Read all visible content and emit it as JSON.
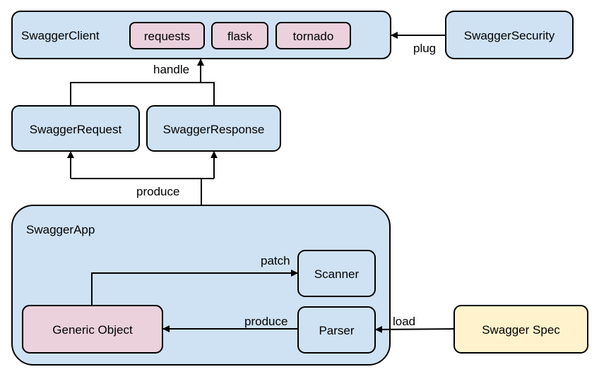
{
  "colors": {
    "blue": "#cfe2f3",
    "pink": "#ead1dc",
    "yellow": "#fff2cc"
  },
  "nodes": {
    "client": "SwaggerClient",
    "requests": "requests",
    "flask": "flask",
    "tornado": "tornado",
    "security": "SwaggerSecurity",
    "request": "SwaggerRequest",
    "response": "SwaggerResponse",
    "app": "SwaggerApp",
    "scanner": "Scanner",
    "parser": "Parser",
    "generic": "Generic Object",
    "spec": "Swagger Spec"
  },
  "edges": {
    "plug": "plug",
    "handle": "handle",
    "produce_top": "produce",
    "patch": "patch",
    "produce_inner": "produce",
    "load": "load"
  }
}
